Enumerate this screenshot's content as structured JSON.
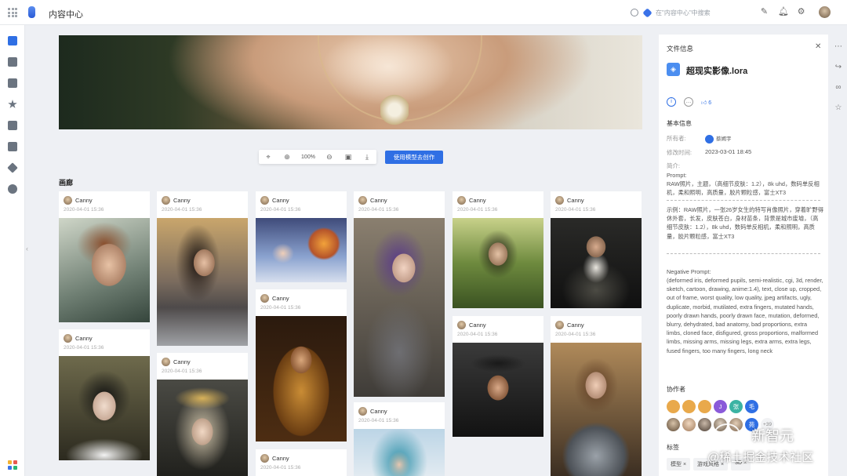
{
  "app": {
    "title": "内容中心"
  },
  "search": {
    "placeholder": "在\"内容中心\"中搜索"
  },
  "toolbar": {
    "zoom": "100%",
    "create_label": "使用模型去创作"
  },
  "gallery": {
    "title": "画廊",
    "cards": [
      {
        "user": "Canny",
        "date": "2020-04-01 15:36"
      },
      {
        "user": "Canny",
        "date": "2020-04-01 15:36"
      },
      {
        "user": "Canny",
        "date": "2020-04-01 15:36"
      },
      {
        "user": "Canny",
        "date": "2020-04-01 15:36"
      },
      {
        "user": "Canny",
        "date": "2020-04-01 15:36"
      },
      {
        "user": "Canny",
        "date": "2020-04-01 15:36"
      },
      {
        "user": "Canny",
        "date": "2020-04-01 15:36"
      },
      {
        "user": "Canny",
        "date": "2020-04-01 15:36"
      },
      {
        "user": "Canny",
        "date": "2020-04-01 15:36"
      },
      {
        "user": "Canny",
        "date": "2020-04-01 15:36"
      },
      {
        "user": "Canny",
        "date": "2020-04-01 15:36"
      },
      {
        "user": "Canny",
        "date": "2020-04-01 15:36"
      },
      {
        "user": "Canny",
        "date": "2020-04-01 15:36"
      }
    ]
  },
  "panel": {
    "title": "文件信息",
    "file_name": "超现实影像.lora",
    "likes": "6",
    "basic_info_title": "基本信息",
    "owner_label": "所有者:",
    "owner_name": "蔡嫣宇",
    "modified_label": "修改时间:",
    "modified_value": "2023-03-01 18:45",
    "desc_label": "简介:",
    "prompt_label": "Prompt:",
    "prompt_text": "RAW照片，主题，（高细节皮肤：1.2），8k uhd，数码单反相机，柔和照明，高质量，胶片颗粒感，富士XT3",
    "example_text": "示例：RAW照片，一张26岁女生的特写肖像照片，穿着旷野得休外套，长发，皮肤苍白，身材苗条，背景是城市废墟，（高细节皮肤：1.2），8k uhd，数码单反相机，柔和照明，高质量，胶片颗粒感，富士XT3",
    "negative_label": "Negative Prompt:",
    "negative_text": "(deformed iris, deformed pupils, semi-realistic, cgi, 3d, render, sketch, cartoon, drawing, anime:1.4), text, close up, cropped, out of frame, worst quality, low quality, jpeg artifacts, ugly, duplicate, morbid, mutilated, extra fingers, mutated hands, poorly drawn hands, poorly drawn face, mutation, deformed, blurry, dehydrated, bad anatomy, bad proportions, extra limbs, cloned face, disfigured, gross proportions, malformed limbs, missing arms, missing legs, extra arms, extra legs, fused fingers, too many fingers, long neck",
    "collab_title": "协作者",
    "collab_row1": [
      "",
      "",
      "",
      "J",
      "张",
      "毛"
    ],
    "collab_more": "+39",
    "tags_title": "标签",
    "tags": [
      "模型 ×",
      "游戏风格 ×",
      "3D ×"
    ]
  },
  "watermark": {
    "line1": "新智元",
    "line2": "@稀土掘金技术社区"
  },
  "colors": {
    "accent": "#2f6fe4"
  }
}
